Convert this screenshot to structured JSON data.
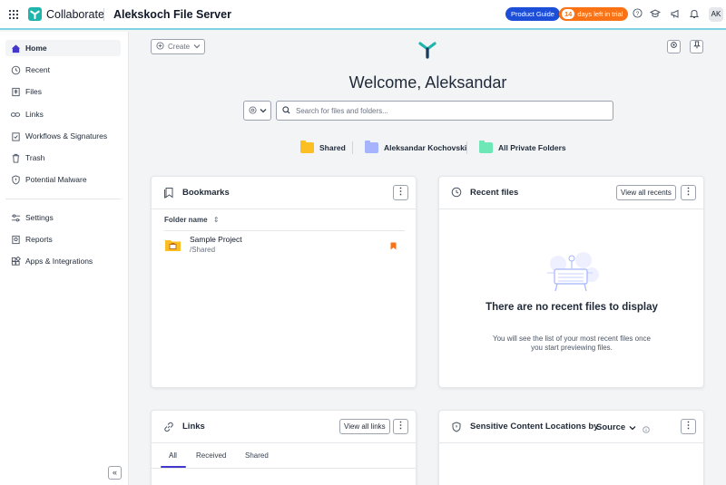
{
  "topbar": {
    "app_name": "Collaborate",
    "server_name": "Alekskoch File Server",
    "product_guide": "Product Guide",
    "trial_days": "14",
    "trial_text": "days left in trial",
    "avatar_initials": "AK"
  },
  "sidebar": {
    "items": [
      {
        "label": "Home",
        "icon": "home-icon"
      },
      {
        "label": "Recent",
        "icon": "clock-icon"
      },
      {
        "label": "Files",
        "icon": "files-icon"
      },
      {
        "label": "Links",
        "icon": "link-icon"
      },
      {
        "label": "Workflows & Signatures",
        "icon": "workflow-icon"
      },
      {
        "label": "Trash",
        "icon": "trash-icon"
      },
      {
        "label": "Potential Malware",
        "icon": "shield-icon"
      },
      {
        "label": "Settings",
        "icon": "sliders-icon"
      },
      {
        "label": "Reports",
        "icon": "report-icon"
      },
      {
        "label": "Apps & Integrations",
        "icon": "apps-icon"
      }
    ]
  },
  "main": {
    "create_label": "Create",
    "welcome": "Welcome, Aleksandar",
    "search_placeholder": "Search for files and folders...",
    "shortcuts": [
      {
        "label": "Shared",
        "color": "#fbbf24"
      },
      {
        "label": "Aleksandar Kochovski",
        "color": "#a5b4fc"
      },
      {
        "label": "All Private Folders",
        "color": "#6ee7b7"
      }
    ]
  },
  "bookmarks": {
    "title": "Bookmarks",
    "column": "Folder name",
    "rows": [
      {
        "name": "Sample Project",
        "path": "/Shared"
      }
    ]
  },
  "recent": {
    "title": "Recent files",
    "view_all": "View all recents",
    "empty_title": "There are no recent files to display",
    "empty_desc": "You will see the list of your most recent files once you start previewing files."
  },
  "links": {
    "title": "Links",
    "view_all": "View all links",
    "tabs": [
      "All",
      "Received",
      "Shared"
    ]
  },
  "sensitive": {
    "title": "Sensitive Content Locations by",
    "dropdown": "Source"
  },
  "colors": {
    "accent": "#4338ca",
    "brand_teal": "#1fb5ad",
    "guide_blue": "#1d4ed8",
    "trial_orange": "#f97316",
    "bookmark_orange": "#f97316"
  }
}
